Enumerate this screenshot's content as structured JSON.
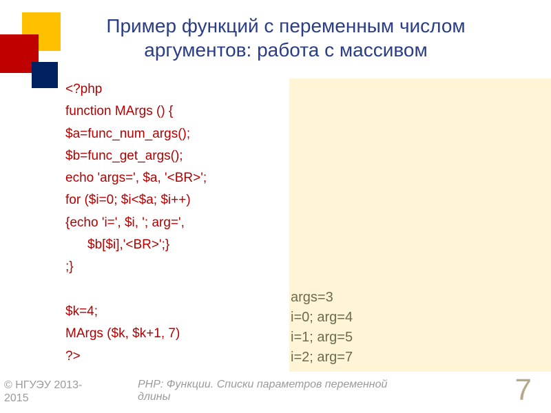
{
  "title_line1": "Пример функций с переменным числом",
  "title_line2": "аргументов: работа с массивом",
  "code": {
    "l1": "<?php",
    "l2": "function MArgs () {",
    "l3": "$a=func_num_args();",
    "l4": "$b=func_get_args();",
    "l5": "echo 'args=', $a, '<BR>';",
    "l6": "for ($i=0; $i<$a; $i++)",
    "l7": "{echo 'i=', $i, '; arg=',",
    "l7b": "$b[$i],'<BR>';}",
    "l8": ";}",
    "l9": "$k=4;",
    "l10": "MArgs ($k, $k+1, 7)",
    "l11": "?>"
  },
  "output": {
    "o1": "args=3",
    "o2": "i=0; arg=4",
    "o3": "i=1; arg=5",
    "o4": "i=2; arg=7"
  },
  "footer": {
    "copy_l1": "© НГУЭУ 2013-",
    "copy_l2": "2015",
    "center": "PHP: Функции. Списки параметров переменной длины",
    "page": "7"
  }
}
